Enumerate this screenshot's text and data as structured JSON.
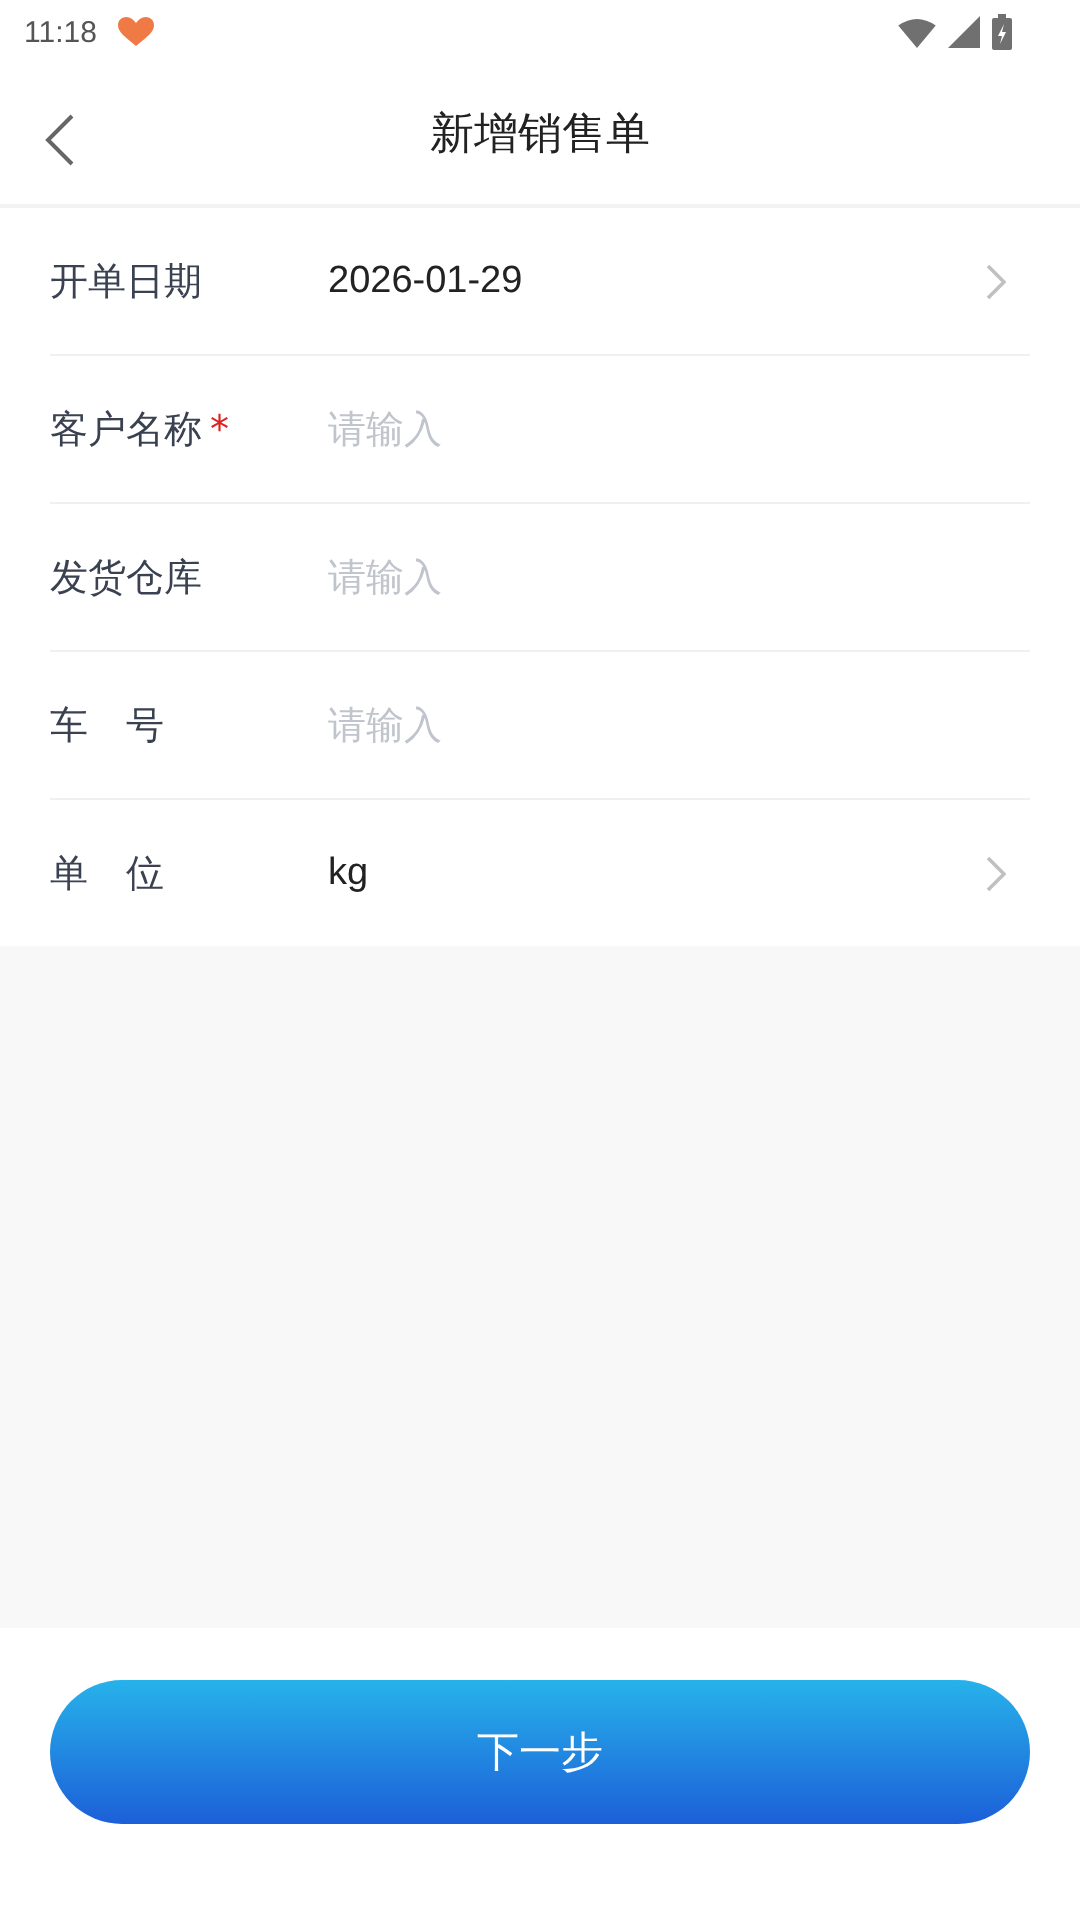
{
  "status_bar": {
    "time": "11:18"
  },
  "header": {
    "title": "新增销售单"
  },
  "form_rows": [
    {
      "label": "开单日期",
      "kind": "select",
      "value": "2026-01-29"
    },
    {
      "label": "客户名称",
      "required_mark": "*",
      "kind": "input",
      "placeholder": "请输入"
    },
    {
      "label": "发货仓库",
      "kind": "input",
      "placeholder": "请输入"
    },
    {
      "label": "车　号",
      "kind": "input",
      "placeholder": "请输入"
    },
    {
      "label": "单　位",
      "kind": "select",
      "value": "kg"
    }
  ],
  "footer": {
    "button": "下一步"
  }
}
